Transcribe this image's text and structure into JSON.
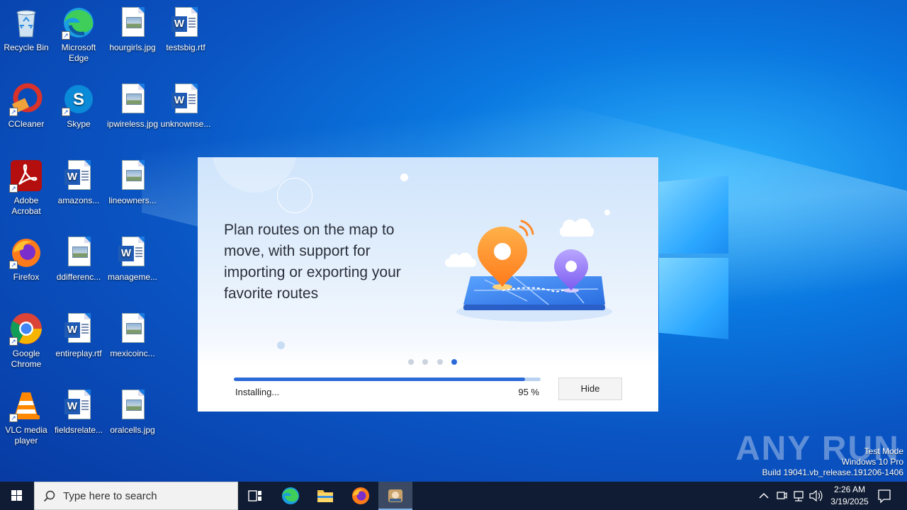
{
  "desktop": {
    "icons": [
      {
        "label": "Recycle Bin"
      },
      {
        "label": "Microsoft Edge"
      },
      {
        "label": "hourgirls.jpg"
      },
      {
        "label": "testsbig.rtf"
      },
      {
        "label": "CCleaner"
      },
      {
        "label": "Skype"
      },
      {
        "label": "ipwireless.jpg"
      },
      {
        "label": "unknownse..."
      },
      {
        "label": "Adobe Acrobat"
      },
      {
        "label": "amazons..."
      },
      {
        "label": "lineowners..."
      },
      {
        "label": "Firefox"
      },
      {
        "label": "ddifferenc..."
      },
      {
        "label": "manageme..."
      },
      {
        "label": "Google Chrome"
      },
      {
        "label": "entireplay.rtf"
      },
      {
        "label": "mexicoinc..."
      },
      {
        "label": "VLC media player"
      },
      {
        "label": "fieldsrelate..."
      },
      {
        "label": "oralcells.jpg"
      }
    ],
    "word_glyph": "W"
  },
  "installer": {
    "headline": "Plan routes on the map to move, with support for importing or exporting your favorite routes",
    "pager": {
      "count": 4,
      "active": 4
    },
    "progress": {
      "percent": 95,
      "status": "Installing...",
      "percent_label": "95 %"
    },
    "hide_label": "Hide",
    "accent": "#2c6ad8"
  },
  "watermark": "ANY RUN",
  "build_info": {
    "line1": "Test Mode",
    "line2": "Windows 10 Pro",
    "line3": "Build 19041.vb_release.191206-1406"
  },
  "taskbar": {
    "search_placeholder": "Type here to search",
    "clock_time": "2:26 AM",
    "clock_date": "3/19/2025"
  }
}
